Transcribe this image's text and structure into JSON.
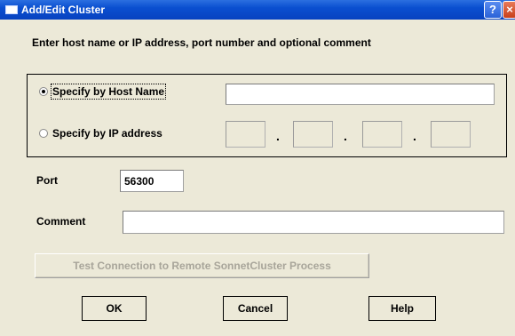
{
  "window": {
    "title": "Add/Edit Cluster",
    "help_glyph": "?",
    "close_glyph": "×"
  },
  "instruction": "Enter host name or IP address, port number and optional comment",
  "host_group": {
    "host_name_option": {
      "label": "Specify by Host Name",
      "selected": true
    },
    "host_name_value": "",
    "ip_option": {
      "label": "Specify by IP address",
      "selected": false
    },
    "ip_octets": [
      "",
      "",
      "",
      ""
    ],
    "ip_separator": "."
  },
  "port": {
    "label": "Port",
    "value": "56300"
  },
  "comment": {
    "label": "Comment",
    "value": ""
  },
  "test_button": {
    "label": "Test Connection to Remote SonnetCluster Process",
    "enabled": false
  },
  "buttons": {
    "ok": "OK",
    "cancel": "Cancel",
    "help": "Help"
  },
  "colors": {
    "titlebar": "#0a4fd0",
    "dialog_bg": "#ece9d8",
    "disabled_text": "#a8a59a"
  }
}
